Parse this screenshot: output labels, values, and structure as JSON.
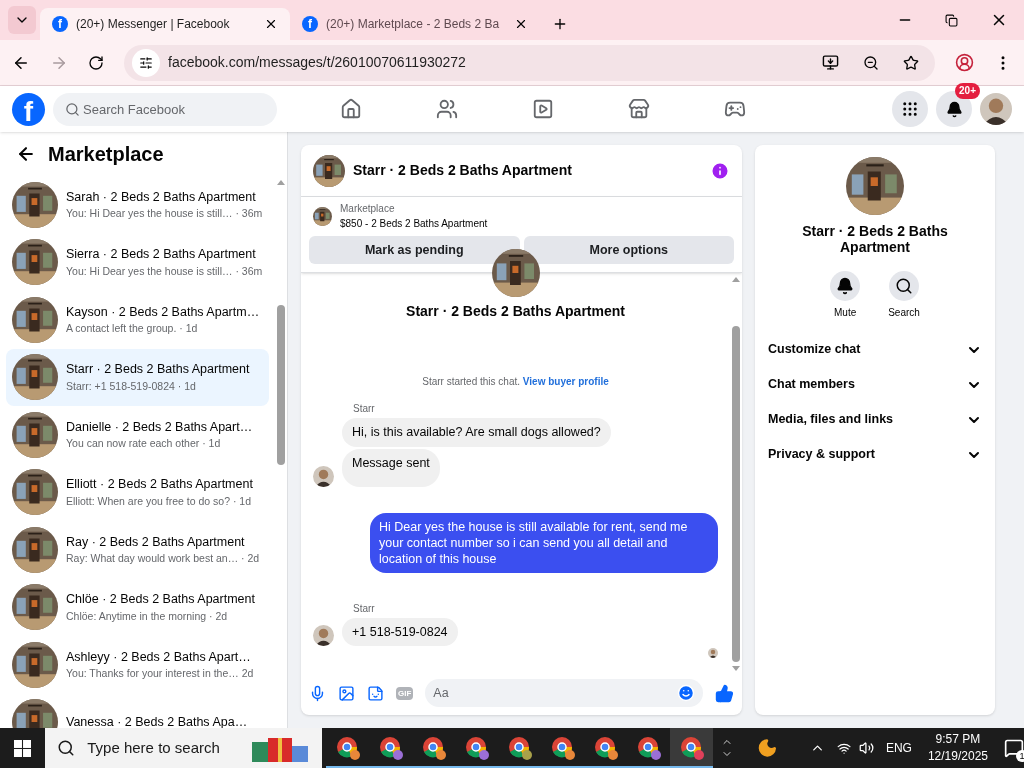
{
  "browser": {
    "tabs": [
      {
        "title": "(20+) Messenger | Facebook",
        "icon_glyph": "f",
        "selected": true
      },
      {
        "title": "(20+) Marketplace - 2 Beds 2 Ba",
        "icon_glyph": "f",
        "selected": false
      }
    ],
    "url": "facebook.com/messages/t/26010070611930272"
  },
  "header": {
    "logo_glyph": "f",
    "search_placeholder": "Search Facebook",
    "nav": [
      {
        "kind": "home"
      },
      {
        "kind": "friends"
      },
      {
        "kind": "video"
      },
      {
        "kind": "marketplace"
      },
      {
        "kind": "gaming"
      }
    ],
    "notification_count": "20+"
  },
  "sidebar": {
    "title": "Marketplace",
    "conversations": [
      {
        "name": "Sarah · 2 Beds 2 Baths Apartment",
        "preview": "You: Hi Dear yes the house is still… · 36m",
        "selected": false
      },
      {
        "name": "Sierra · 2 Beds 2 Baths Apartment",
        "preview": "You: Hi Dear yes the house is still… · 36m",
        "selected": false
      },
      {
        "name": "Kayson · 2 Beds 2 Baths Apartm…",
        "preview": "A contact left the group. · 1d",
        "selected": false
      },
      {
        "name": "Starr · 2 Beds 2 Baths Apartment",
        "preview": "Starr: +1 518-519-0824 · 1d",
        "selected": true
      },
      {
        "name": "Danielle · 2 Beds 2 Baths Apart…",
        "preview": "You can now rate each other · 1d",
        "selected": false
      },
      {
        "name": "Elliott · 2 Beds 2 Baths Apartment",
        "preview": "Elliott: When are you free to do so? · 1d",
        "selected": false
      },
      {
        "name": "Ray · 2 Beds 2 Baths Apartment",
        "preview": "Ray: What day would work best an… · 2d",
        "selected": false
      },
      {
        "name": "Chlöe · 2 Beds 2 Baths Apartment",
        "preview": "Chlöe: Anytime in the morning · 2d",
        "selected": false
      },
      {
        "name": "Ashleyy · 2 Beds 2 Baths Apart…",
        "preview": "You: Thanks for your interest in the… 2d",
        "selected": false
      },
      {
        "name": "Vanessa · 2 Beds 2 Baths Apa…",
        "selected": false
      }
    ]
  },
  "chat": {
    "title": "Starr · 2 Beds 2 Baths Apartment",
    "listing": {
      "label": "Marketplace",
      "detail": "$850 - 2 Beds 2 Baths Apartment"
    },
    "actions": [
      "Mark as pending",
      "More options"
    ],
    "intro_title": "Starr · 2 Beds 2 Baths Apartment",
    "intro_note": "Starr started this chat.",
    "intro_link": "View buyer profile",
    "messages": [
      {
        "kind": "incoming",
        "sender": "Starr",
        "bubbles": [
          "Hi, is this available? Are small dogs allowed?",
          "Message sent"
        ]
      },
      {
        "kind": "outgoing",
        "bubbles": [
          "Hi Dear yes the house is still available for rent, send me your contact number so i can send you all detail and location of this house"
        ]
      },
      {
        "kind": "incoming",
        "sender": "Starr",
        "bubbles": [
          "+1 518-519-0824"
        ]
      }
    ],
    "composer": {
      "gif_label": "GIF",
      "placeholder": "Aa"
    }
  },
  "details": {
    "title": "Starr · 2 Beds 2 Baths Apartment",
    "actions": [
      {
        "kind": "mute",
        "label": "Mute"
      },
      {
        "kind": "search",
        "label": "Search"
      }
    ],
    "sections": [
      {
        "label": "Customize chat",
        "expanded": false
      },
      {
        "label": "Chat members",
        "expanded": false
      },
      {
        "label": "Media, files and links",
        "expanded": false
      },
      {
        "label": "Privacy & support",
        "expanded": false
      }
    ]
  },
  "taskbar": {
    "search_placeholder": "Type here to search",
    "apps": [
      {
        "color": "#e8873a",
        "selected": false
      },
      {
        "color": "#9b6fd6",
        "selected": false
      },
      {
        "color": "#e8873a",
        "selected": false
      },
      {
        "color": "#9b6fd6",
        "selected": false
      },
      {
        "color": "#a9a14a",
        "selected": false
      },
      {
        "color": "#e8873a",
        "selected": false
      },
      {
        "color": "#e8873a",
        "selected": false
      },
      {
        "color": "#9b6fd6",
        "selected": false
      },
      {
        "color": "#e0405a",
        "selected": true
      }
    ],
    "language": "ENG",
    "time": "9:57 PM",
    "date": "12/19/2025",
    "notification_count": "1"
  }
}
